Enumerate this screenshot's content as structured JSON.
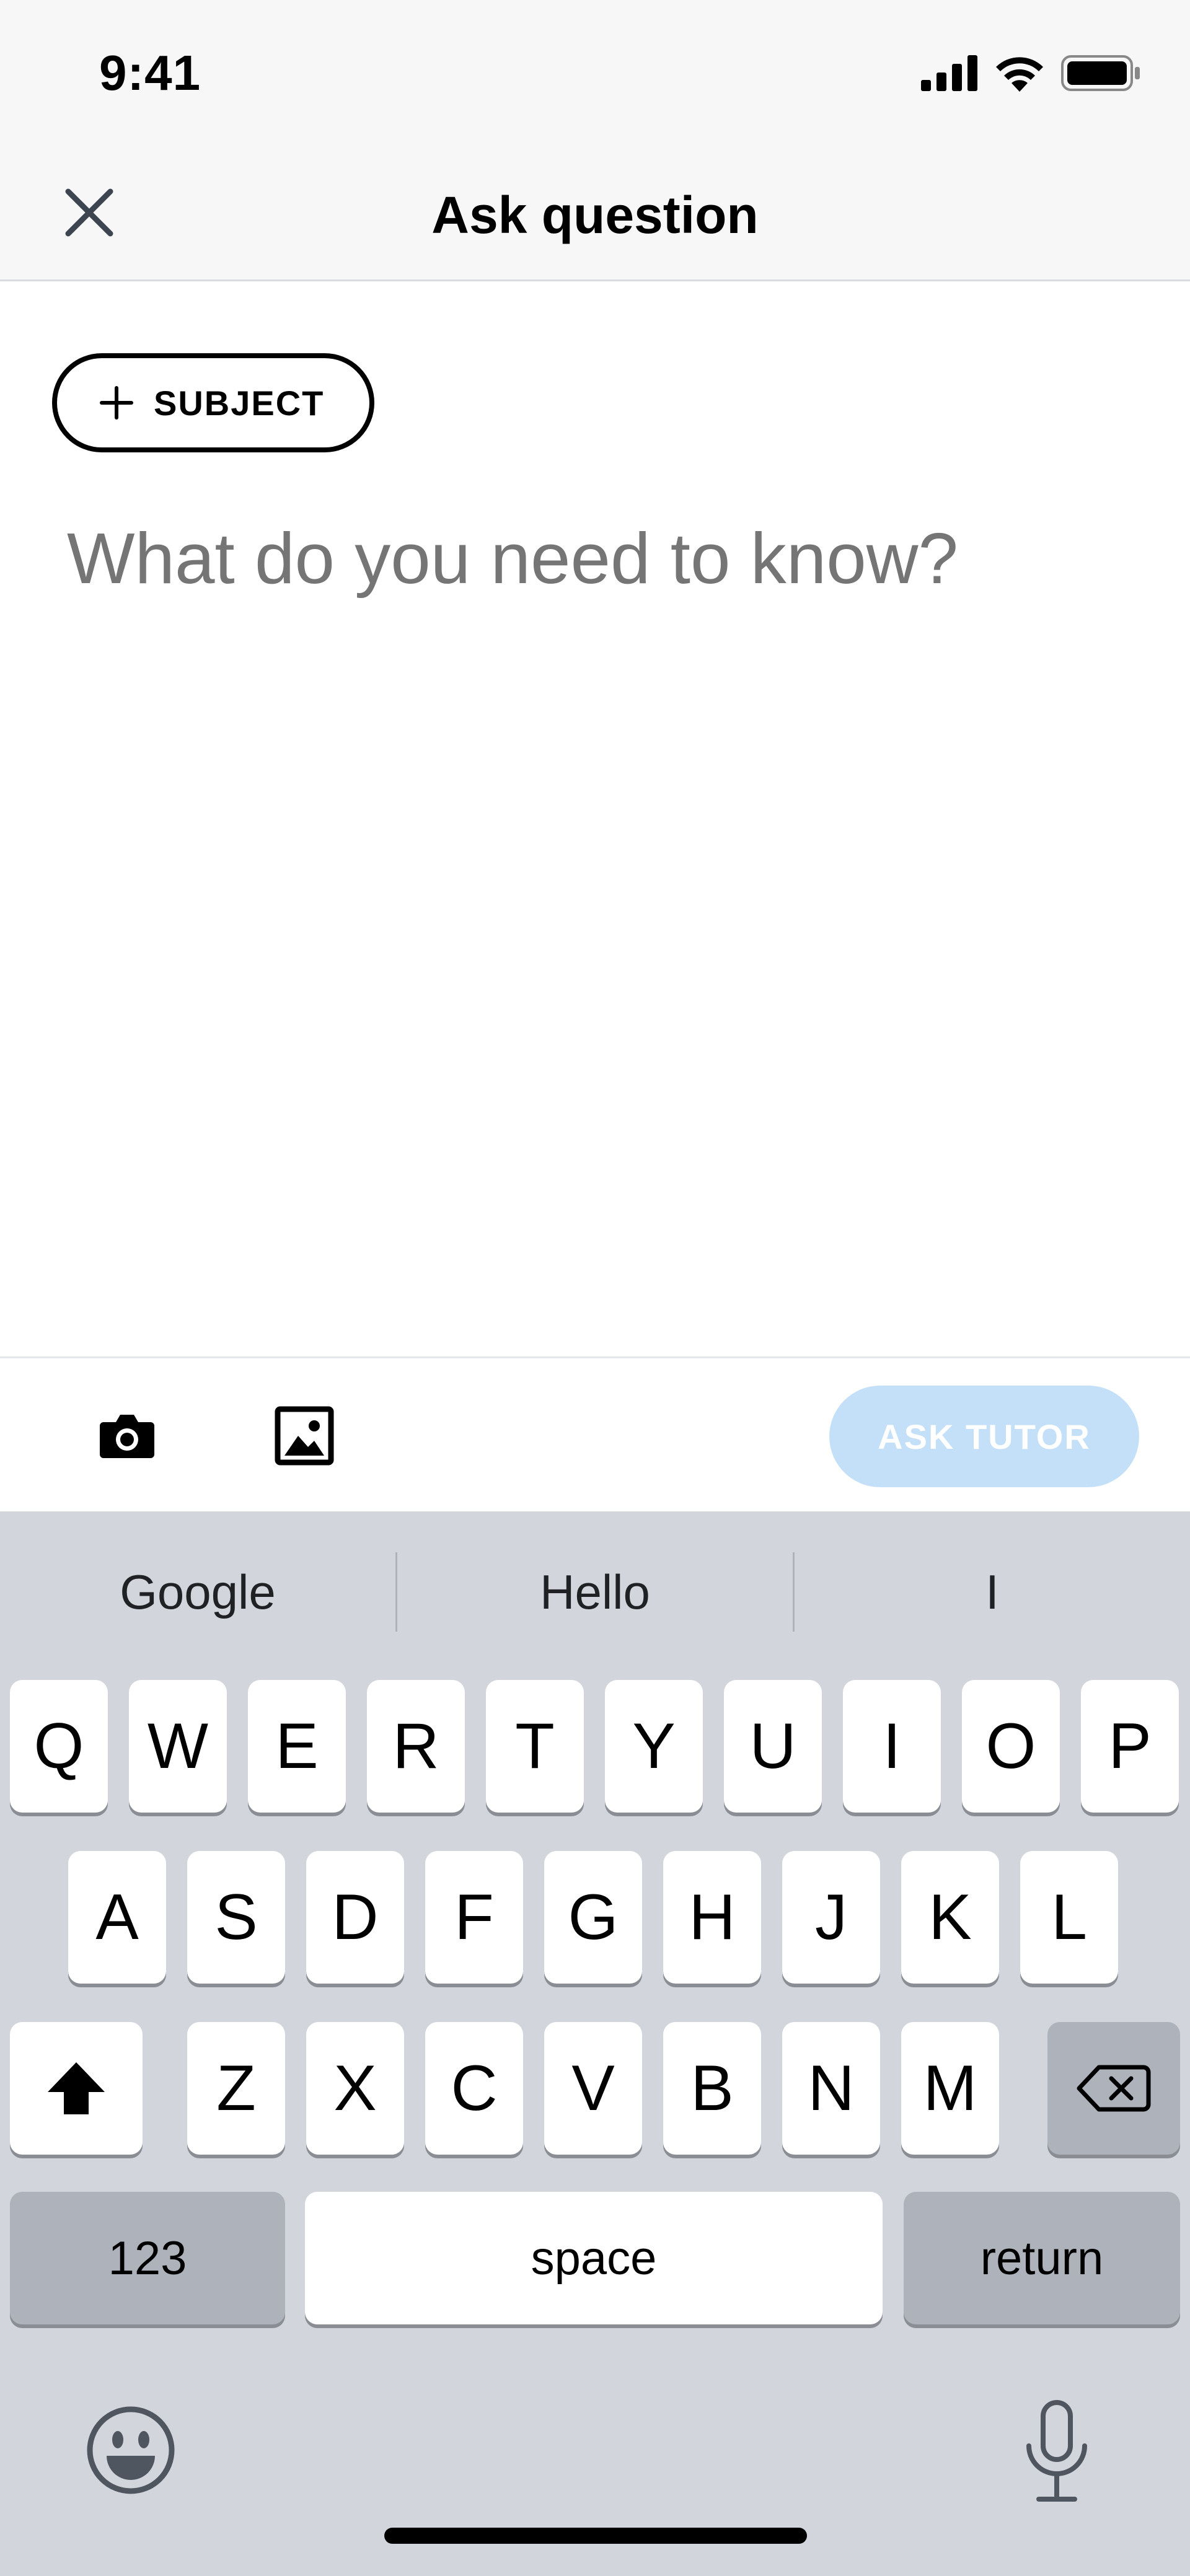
{
  "status_bar": {
    "time": "9:41",
    "icons": [
      "cellular-signal-icon",
      "wifi-icon",
      "battery-icon"
    ]
  },
  "header": {
    "title": "Ask question",
    "close_icon": "close-icon"
  },
  "composer": {
    "subject_button_label": "SUBJECT",
    "question_placeholder": "What do you need to know?",
    "question_value": ""
  },
  "toolbar": {
    "camera_icon": "camera-icon",
    "gallery_icon": "image-icon",
    "ask_button_label": "ASK TUTOR",
    "ask_button_state": "disabled"
  },
  "keyboard": {
    "suggestions": [
      "Google",
      "Hello",
      "I"
    ],
    "row1": [
      "Q",
      "W",
      "E",
      "R",
      "T",
      "Y",
      "U",
      "I",
      "O",
      "P"
    ],
    "row2": [
      "A",
      "S",
      "D",
      "F",
      "G",
      "H",
      "J",
      "K",
      "L"
    ],
    "row3": [
      "Z",
      "X",
      "C",
      "V",
      "B",
      "N",
      "M"
    ],
    "numbers_key": "123",
    "space_key": "space",
    "return_key": "return",
    "shift_icon": "shift-icon",
    "delete_icon": "backspace-icon",
    "emoji_icon": "emoji-icon",
    "mic_icon": "microphone-icon"
  },
  "colors": {
    "accent_disabled": "#c4e0f8",
    "keyboard_bg": "#d2d5db",
    "placeholder": "#6e7884"
  }
}
